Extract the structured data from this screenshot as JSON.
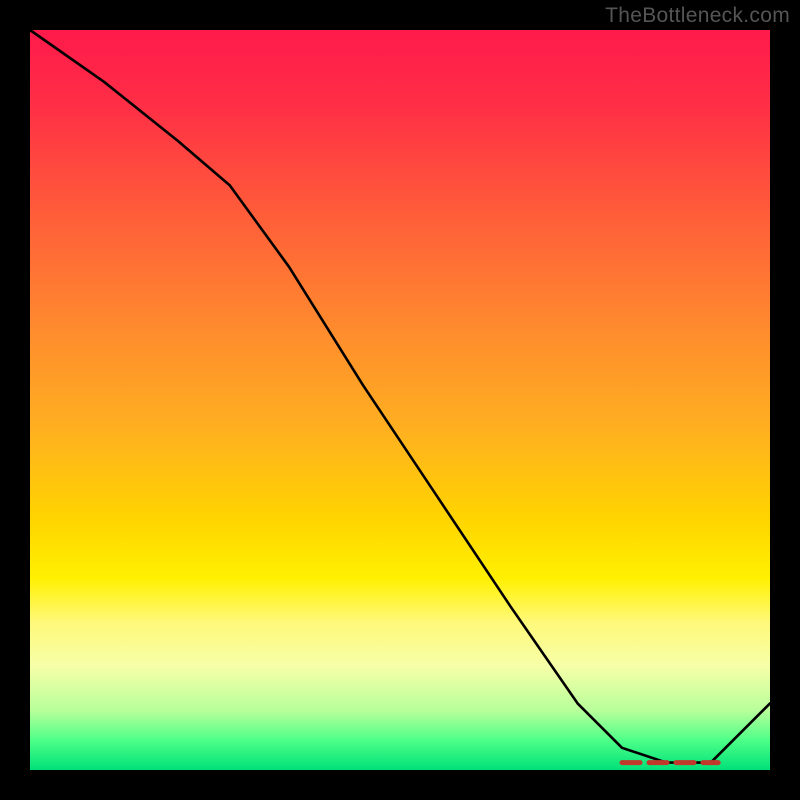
{
  "watermark": "TheBottleneck.com",
  "chart_data": {
    "type": "line",
    "title": "",
    "xlabel": "",
    "ylabel": "",
    "xlim": [
      0,
      100
    ],
    "ylim": [
      0,
      100
    ],
    "grid": false,
    "background": "red-to-green-vertical-gradient",
    "series": [
      {
        "name": "bottleneck-curve",
        "x": [
          0,
          10,
          20,
          27,
          35,
          45,
          55,
          65,
          74,
          80,
          86,
          92,
          100
        ],
        "y": [
          100,
          93,
          85,
          79,
          68,
          52,
          37,
          22,
          9,
          3,
          1,
          1,
          9
        ]
      }
    ],
    "annotations": [
      {
        "name": "optimal-range-marker",
        "type": "flat-dashed-segment",
        "x_start": 80,
        "x_end": 93,
        "y": 1,
        "color": "#c0392b"
      }
    ]
  }
}
